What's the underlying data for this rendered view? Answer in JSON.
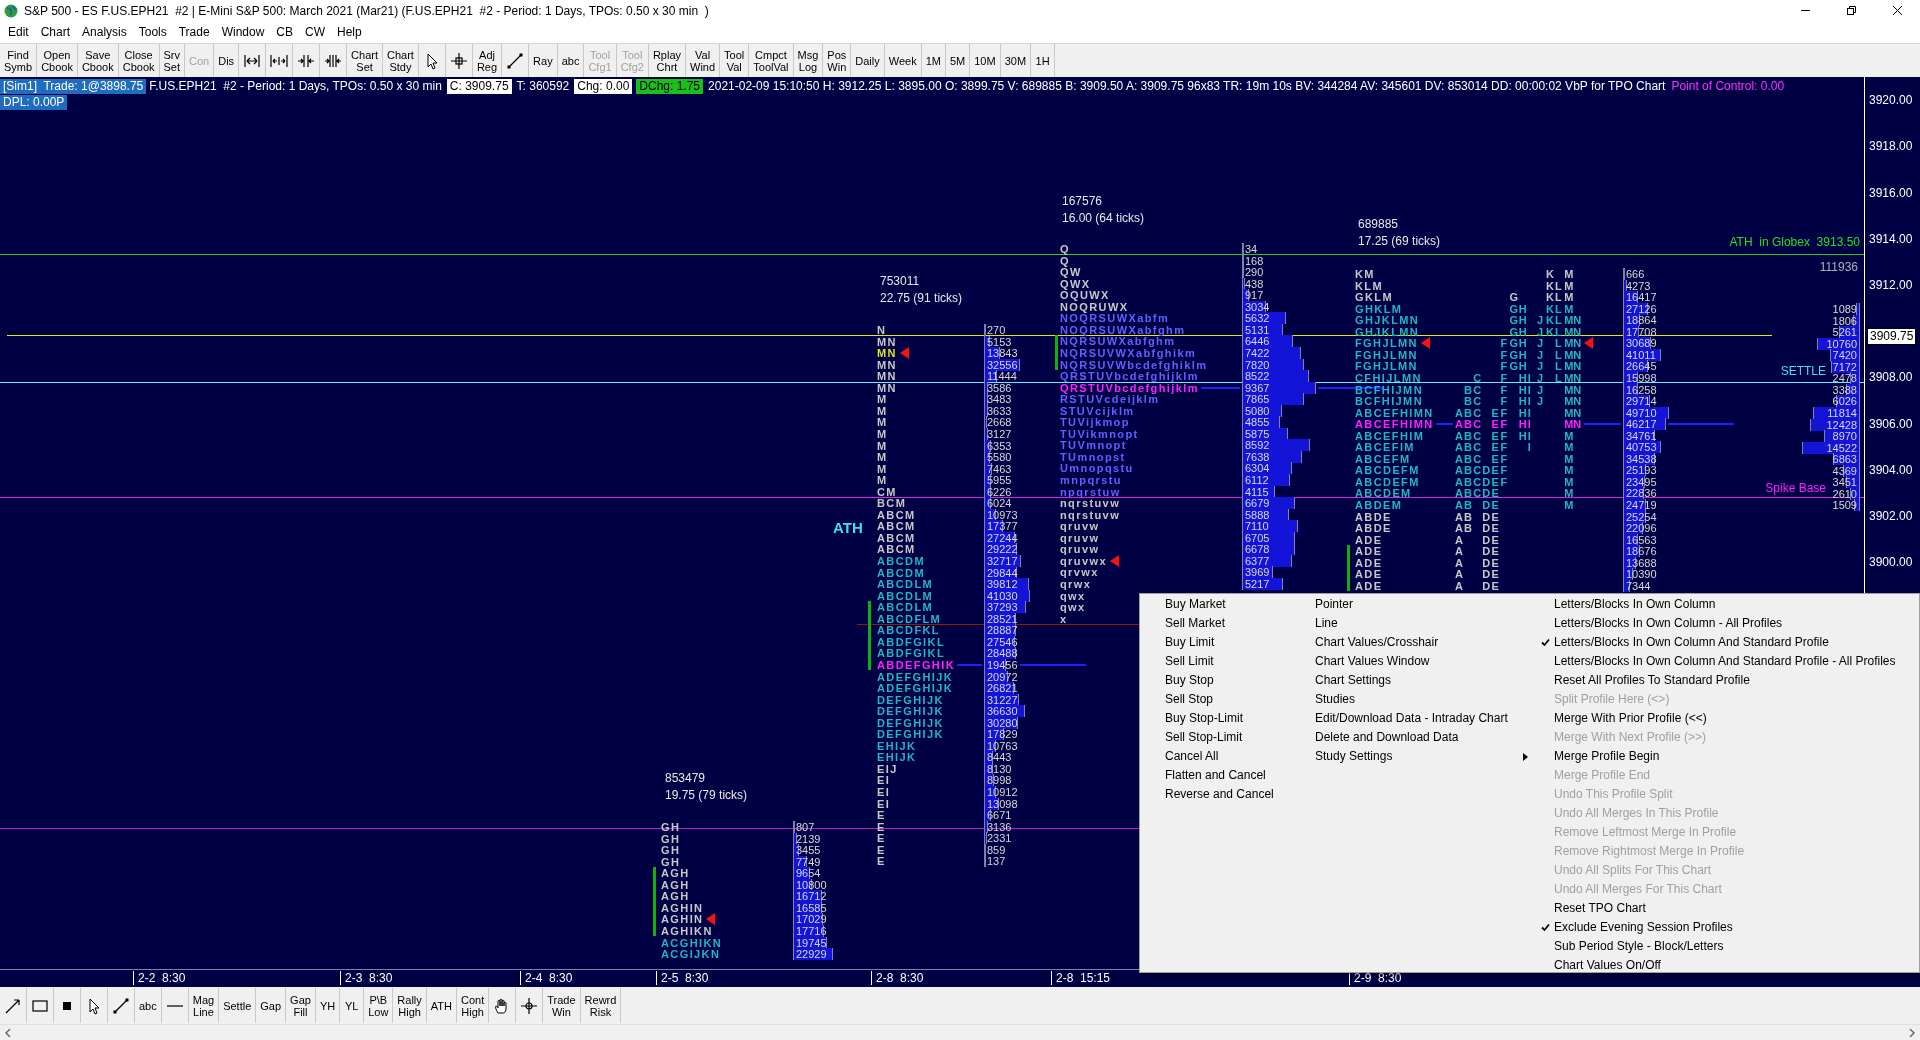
{
  "window": {
    "title": "S&P 500 - ES F.US.EPH21  #2 | E-Mini S&P 500: March 2021 (Mar21) (F.US.EPH21  #2 - Period: 1 Days, TPOs: 0.50 x 30 min  )"
  },
  "menu": [
    "Edit",
    "Chart",
    "Analysis",
    "Tools",
    "Trade",
    "Window",
    "CB",
    "CW",
    "Help"
  ],
  "toolbar": [
    {
      "kind": "text",
      "lines": [
        "Find",
        "Symb"
      ],
      "disabled": false
    },
    {
      "kind": "text",
      "lines": [
        "Open",
        "Cbook"
      ],
      "disabled": false
    },
    {
      "kind": "text",
      "lines": [
        "Save",
        "Cbook"
      ],
      "disabled": false
    },
    {
      "kind": "text",
      "lines": [
        "Close",
        "Cbook"
      ],
      "disabled": false
    },
    {
      "kind": "text",
      "lines": [
        "Srv",
        "Set"
      ],
      "disabled": false
    },
    {
      "kind": "text",
      "lines": [
        "Con"
      ],
      "disabled": true
    },
    {
      "kind": "text",
      "lines": [
        "Dis"
      ],
      "disabled": false
    },
    {
      "kind": "icon"
    },
    {
      "kind": "icon"
    },
    {
      "kind": "icon"
    },
    {
      "kind": "icon"
    },
    {
      "kind": "text",
      "lines": [
        "Chart",
        "Set"
      ],
      "disabled": false
    },
    {
      "kind": "text",
      "lines": [
        "Chart",
        "Stdy"
      ],
      "disabled": false
    },
    {
      "kind": "icon"
    },
    {
      "kind": "icon"
    },
    {
      "kind": "text",
      "lines": [
        "Adj",
        "Reg"
      ],
      "disabled": false
    },
    {
      "kind": "icon"
    },
    {
      "kind": "text",
      "lines": [
        "Ray"
      ],
      "disabled": false
    },
    {
      "kind": "text",
      "lines": [
        "abc"
      ],
      "disabled": false
    },
    {
      "kind": "text",
      "lines": [
        "Tool",
        "Cfg1"
      ],
      "disabled": true
    },
    {
      "kind": "text",
      "lines": [
        "Tool",
        "Cfg2"
      ],
      "disabled": true
    },
    {
      "kind": "text",
      "lines": [
        "Rplay",
        "Chrt"
      ],
      "disabled": false
    },
    {
      "kind": "text",
      "lines": [
        "Val",
        "Wind"
      ],
      "disabled": false
    },
    {
      "kind": "text",
      "lines": [
        "Tool",
        "Val"
      ],
      "disabled": false
    },
    {
      "kind": "text",
      "lines": [
        "Cmpct",
        "ToolVal"
      ],
      "disabled": false
    },
    {
      "kind": "text",
      "lines": [
        "Msg",
        "Log"
      ],
      "disabled": false
    },
    {
      "kind": "text",
      "lines": [
        "Pos",
        "Win"
      ],
      "disabled": false
    },
    {
      "kind": "text",
      "lines": [
        "Daily"
      ],
      "disabled": false
    },
    {
      "kind": "text",
      "lines": [
        "Week"
      ],
      "disabled": false
    },
    {
      "kind": "text",
      "lines": [
        "1M"
      ],
      "disabled": false
    },
    {
      "kind": "text",
      "lines": [
        "5M"
      ],
      "disabled": false
    },
    {
      "kind": "text",
      "lines": [
        "10M"
      ],
      "disabled": false
    },
    {
      "kind": "text",
      "lines": [
        "30M"
      ],
      "disabled": false
    },
    {
      "kind": "text",
      "lines": [
        "1H"
      ],
      "disabled": false
    }
  ],
  "info_bar": [
    [
      {
        "kind": "account",
        "text": "[Sim1]  Trade: 1@3898.75"
      },
      {
        "kind": "plain",
        "text": "F.US.EPH21  #2 - Period: 1 Days, TPOs: 0.50 x 30 min"
      },
      {
        "kind": "boxed",
        "text": "C: 3909.75"
      },
      {
        "kind": "plain",
        "text": "T: 360592"
      },
      {
        "kind": "boxed",
        "text": "Chg: 0.00"
      },
      {
        "kind": "up",
        "text": "DChg: 1.75"
      },
      {
        "kind": "plain",
        "text": "2021-02-09 15:10:50 H: 3912.25 L: 3895.00 O: 3899.75 V: 689885 B: 3909.50 A: 3909.75 96x83 TR: 19m 10s BV: 344284 AV: 345601 DV: 853014 DD: 00:00:02 VbP for TPO Chart"
      },
      {
        "kind": "poc",
        "text": "Point of Control: 0.00"
      }
    ],
    [
      {
        "kind": "account",
        "text": "DPL: 0.00P"
      }
    ]
  ],
  "profiles": [
    {
      "total": "753011",
      "range": "22.75 (91 ticks)",
      "rows": [
        {
          "letters": "N",
          "volume": "270",
          "color": "#c8c8c8"
        },
        {
          "letters": "MN",
          "volume": "5153",
          "color": "#c8c8c8"
        },
        {
          "letters": "MN",
          "volume": "13843",
          "color": "#e0e020",
          "close_marker": true
        },
        {
          "letters": "MN",
          "volume": "32556",
          "color": "#c8c8c8"
        },
        {
          "letters": "MN",
          "volume": "11444",
          "color": "#c8c8c8"
        },
        {
          "letters": "MN",
          "volume": "3586",
          "color": "#c8c8c8"
        },
        {
          "letters": "M",
          "volume": "3483",
          "color": "#c8c8c8"
        },
        {
          "letters": "M",
          "volume": "3633",
          "color": "#c8c8c8"
        },
        {
          "letters": "M",
          "volume": "2668",
          "color": "#c8c8c8"
        },
        {
          "letters": "M",
          "volume": "3127",
          "color": "#c8c8c8"
        },
        {
          "letters": "M",
          "volume": "6353",
          "color": "#c8c8c8"
        },
        {
          "letters": "M",
          "volume": "5580",
          "color": "#c8c8c8"
        },
        {
          "letters": "M",
          "volume": "7463",
          "color": "#c8c8c8"
        },
        {
          "letters": "M",
          "volume": "5955",
          "color": "#c8c8c8"
        },
        {
          "letters": "CM",
          "volume": "6226",
          "color": "#c8c8c8"
        },
        {
          "letters": "BCM",
          "volume": "6024",
          "color": "#c8c8c8"
        },
        {
          "letters": "ABCM",
          "volume": "10973",
          "color": "#c8c8c8"
        },
        {
          "letters": "ABCM",
          "volume": "17377",
          "color": "#c8c8c8"
        },
        {
          "letters": "ABCM",
          "volume": "27244",
          "color": "#c8c8c8"
        },
        {
          "letters": "ABCM",
          "volume": "29222",
          "color": "#c8c8c8"
        },
        {
          "letters": "ABCDM",
          "volume": "32717",
          "color": "#20b8c0"
        },
        {
          "letters": "ABCDM",
          "volume": "29844",
          "color": "#20b8c0"
        },
        {
          "letters": "ABCDLM",
          "volume": "39812",
          "color": "#20b8c0"
        },
        {
          "letters": "ABCDLM",
          "volume": "41030",
          "color": "#20b8c0"
        },
        {
          "letters": "ABCDLM",
          "volume": "37293",
          "color": "#20b8c0"
        },
        {
          "letters": "ABCDFLM",
          "volume": "28521",
          "color": "#20b8c0"
        },
        {
          "letters": "ABCDFKL",
          "volume": "28887",
          "color": "#20b8c0"
        },
        {
          "letters": "ABDFGIKL",
          "volume": "27546",
          "color": "#20b8c0"
        },
        {
          "letters": "ABDFGIKL",
          "volume": "28488",
          "color": "#20b8c0"
        },
        {
          "letters": "ABDEFGHIK",
          "volume": "19456",
          "color": "#ff20ff",
          "poc": true
        },
        {
          "letters": "ADEFGHIJK",
          "volume": "20972",
          "color": "#20b8c0"
        },
        {
          "letters": "ADEFGHIJK",
          "volume": "26821",
          "color": "#20b8c0"
        },
        {
          "letters": "DEFGHIJK",
          "volume": "31227",
          "color": "#20b8c0"
        },
        {
          "letters": "DEFGHIJK",
          "volume": "36630",
          "color": "#20b8c0"
        },
        {
          "letters": "DEFGHIJK",
          "volume": "30280",
          "color": "#20b8c0"
        },
        {
          "letters": "DEFGHIJK",
          "volume": "17829",
          "color": "#20b8c0"
        },
        {
          "letters": "EHIJK",
          "volume": "10763",
          "color": "#20b8c0"
        },
        {
          "letters": "EHIJK",
          "volume": "8443",
          "color": "#20b8c0"
        },
        {
          "letters": "EIJ",
          "volume": "8130",
          "color": "#c8c8c8"
        },
        {
          "letters": "EI",
          "volume": "8998",
          "color": "#c8c8c8"
        },
        {
          "letters": "EI",
          "volume": "10912",
          "color": "#c8c8c8"
        },
        {
          "letters": "EI",
          "volume": "13098",
          "color": "#c8c8c8"
        },
        {
          "letters": "E",
          "volume": "6671",
          "color": "#c8c8c8"
        },
        {
          "letters": "E",
          "volume": "3136",
          "color": "#c8c8c8"
        },
        {
          "letters": "E",
          "volume": "2331",
          "color": "#c8c8c8"
        },
        {
          "letters": "E",
          "volume": "859",
          "color": "#c8c8c8"
        },
        {
          "letters": "E",
          "volume": "137",
          "color": "#c8c8c8"
        }
      ]
    },
    {
      "total": "167576",
      "range": "16.00 (64 ticks)",
      "rows": [
        {
          "letters": "Q",
          "volume": "34",
          "color": "#c8c8c8"
        },
        {
          "letters": "Q",
          "volume": "168",
          "color": "#c8c8c8"
        },
        {
          "letters": "QW",
          "volume": "290",
          "color": "#c8c8c8"
        },
        {
          "letters": "QWX",
          "volume": "438",
          "color": "#c8c8c8"
        },
        {
          "letters": "OQUWX",
          "volume": "917",
          "color": "#c8c8c8"
        },
        {
          "letters": "NOQRUWX",
          "volume": "3034",
          "color": "#c8c8c8"
        },
        {
          "letters": "NOQRSUWXabfm",
          "volume": "5632",
          "color": "#6060ff"
        },
        {
          "letters": "NOQRSUWXabfghm",
          "volume": "5131",
          "color": "#6060ff"
        },
        {
          "letters": "NQRSUWXabfghm",
          "volume": "6446",
          "color": "#6060ff"
        },
        {
          "letters": "NQRSUVWXabfghikm",
          "volume": "7422",
          "color": "#6060ff"
        },
        {
          "letters": "NQRSUVWbcdefghiklm",
          "volume": "7820",
          "color": "#6060ff"
        },
        {
          "letters": "QRSTUVbcdefghijklm",
          "volume": "8522",
          "color": "#6060ff"
        },
        {
          "letters": "QRSTUVbcdefghijklm",
          "volume": "9367",
          "color": "#ff20ff",
          "poc": true
        },
        {
          "letters": "RSTUVcdeijklm",
          "volume": "7865",
          "color": "#6060ff"
        },
        {
          "letters": "STUVcijklm",
          "volume": "5080",
          "color": "#6060ff"
        },
        {
          "letters": "TUVijkmop",
          "volume": "4855",
          "color": "#6060ff"
        },
        {
          "letters": "TUVikmnopt",
          "volume": "5875",
          "color": "#6060ff"
        },
        {
          "letters": "TUVmnopt",
          "volume": "8592",
          "color": "#6060ff"
        },
        {
          "letters": "TUmnopst",
          "volume": "7638",
          "color": "#6060ff"
        },
        {
          "letters": "Umnopqstu",
          "volume": "6304",
          "color": "#6060ff"
        },
        {
          "letters": "mnpqrstu",
          "volume": "6112",
          "color": "#6060ff"
        },
        {
          "letters": "npqrstuw",
          "volume": "4115",
          "color": "#6060ff"
        },
        {
          "letters": "nqrstuvw",
          "volume": "6679",
          "color": "#c8c8c8"
        },
        {
          "letters": "nqrstuvw",
          "volume": "5888",
          "color": "#c8c8c8"
        },
        {
          "letters": "qruvw",
          "volume": "7110",
          "color": "#c8c8c8"
        },
        {
          "letters": "qruvw",
          "volume": "6705",
          "color": "#c8c8c8"
        },
        {
          "letters": "qruvw",
          "volume": "6678",
          "color": "#c8c8c8"
        },
        {
          "letters": "qruvwx",
          "volume": "6377",
          "color": "#c8c8c8",
          "close_marker": true
        },
        {
          "letters": "qrvwx",
          "volume": "3969",
          "color": "#c8c8c8"
        },
        {
          "letters": "qrwx",
          "volume": "5217",
          "color": "#c8c8c8"
        },
        {
          "letters": "qwx",
          "color": "#c8c8c8"
        },
        {
          "letters": "qwx",
          "color": "#c8c8c8"
        },
        {
          "letters": "x",
          "color": "#c8c8c8"
        }
      ]
    },
    {
      "total": "689885",
      "range": "17.25 (69 ticks)",
      "rows": [
        {
          "letters": "KM",
          "own_column": [
            "K",
            "M"
          ],
          "volume": "666",
          "color": "#c8c8c8"
        },
        {
          "letters": "KLM",
          "own_column": [
            "KLM"
          ],
          "volume": "4273",
          "color": "#c8c8c8"
        },
        {
          "letters": "GKLM",
          "own_column": [
            "G",
            "KLM"
          ],
          "volume": "16417",
          "color": "#c8c8c8"
        },
        {
          "letters": "GHKLM",
          "own_column": [
            "GH",
            "KLM"
          ],
          "volume": "27126",
          "color": "#20b8c0"
        },
        {
          "letters": "GHJKLMN",
          "own_column": [
            "GH",
            "JKLMN"
          ],
          "volume": "18864",
          "color": "#20b8c0"
        },
        {
          "letters": "GHJKLMN",
          "own_column": [
            "GH",
            "JKLMN"
          ],
          "volume": "17708",
          "color": "#20b8c0"
        },
        {
          "letters": "FGHJLMN",
          "own_column": [
            "FGH",
            "J",
            "LMN"
          ],
          "volume": "30689",
          "color": "#20b8c0",
          "close_marker": true
        },
        {
          "letters": "FGHJLMN",
          "own_column": [
            "FGH",
            "J",
            "LMN"
          ],
          "volume": "41011",
          "color": "#20b8c0"
        },
        {
          "letters": "FGHJLMN",
          "own_column": [
            "FGH",
            "J",
            "LMN"
          ],
          "volume": "26645",
          "color": "#20b8c0"
        },
        {
          "letters": "CFHIJLMN",
          "own_column": [
            "C",
            "F",
            "HI",
            "J",
            "LMN"
          ],
          "volume": "15998",
          "color": "#20b8c0"
        },
        {
          "letters": "BCFHIJMN",
          "own_column": [
            "BC",
            "F",
            "HI",
            "J",
            "MN"
          ],
          "volume": "16258",
          "color": "#20b8c0"
        },
        {
          "letters": "BCFHIJMN",
          "own_column": [
            "BC",
            "F",
            "HI",
            "J",
            "MN"
          ],
          "volume": "29714",
          "color": "#20b8c0"
        },
        {
          "letters": "ABCEFHIMN",
          "own_column": [
            "ABC",
            "EF",
            "HI",
            "MN"
          ],
          "volume": "49710",
          "color": "#20b8c0"
        },
        {
          "letters": "ABCEFHIMN",
          "own_column": [
            "ABC",
            "EF",
            "HI",
            "MN"
          ],
          "volume": "46217",
          "color": "#ff20ff",
          "poc": true
        },
        {
          "letters": "ABCEFHIM",
          "own_column": [
            "ABC",
            "EF",
            "HI",
            "M"
          ],
          "volume": "34761",
          "color": "#20b8c0"
        },
        {
          "letters": "ABCEFIM",
          "own_column": [
            "ABC",
            "EF",
            "I",
            "M"
          ],
          "volume": "40753",
          "color": "#20b8c0"
        },
        {
          "letters": "ABCEFM",
          "own_column": [
            "ABC",
            "EF",
            "M"
          ],
          "volume": "34538",
          "color": "#20b8c0"
        },
        {
          "letters": "ABCDEFM",
          "own_column": [
            "ABCDEF",
            "M"
          ],
          "volume": "25193",
          "color": "#20b8c0"
        },
        {
          "letters": "ABCDEFM",
          "own_column": [
            "ABCDEF",
            "M"
          ],
          "volume": "23495",
          "color": "#20b8c0"
        },
        {
          "letters": "ABCDEM",
          "own_column": [
            "ABCDE",
            "M"
          ],
          "volume": "22836",
          "color": "#20b8c0"
        },
        {
          "letters": "ABDEM",
          "own_column": [
            "AB",
            "DE",
            "M"
          ],
          "volume": "24719",
          "color": "#20b8c0"
        },
        {
          "letters": "ABDE",
          "own_column": [
            "AB",
            "DE"
          ],
          "volume": "25254",
          "color": "#c8c8c8"
        },
        {
          "letters": "ABDE",
          "own_column": [
            "AB",
            "DE"
          ],
          "volume": "22096",
          "color": "#c8c8c8"
        },
        {
          "letters": "ADE",
          "own_column": [
            "A",
            "DE"
          ],
          "volume": "16563",
          "color": "#c8c8c8"
        },
        {
          "letters": "ADE",
          "own_column": [
            "A",
            "DE"
          ],
          "volume": "18676",
          "color": "#c8c8c8"
        },
        {
          "letters": "ADE",
          "own_column": [
            "A",
            "DE"
          ],
          "volume": "13688",
          "color": "#c8c8c8"
        },
        {
          "letters": "ADE",
          "own_column": [
            "A",
            "DE"
          ],
          "volume": "10390",
          "color": "#c8c8c8"
        },
        {
          "letters": "ADE",
          "own_column": [
            "A",
            "DE"
          ],
          "volume": "7344",
          "color": "#c8c8c8"
        }
      ]
    },
    {
      "total": "111936",
      "rows": [
        {
          "volume": "1089"
        },
        {
          "volume": "1806"
        },
        {
          "volume": "5261"
        },
        {
          "volume": "10760"
        },
        {
          "volume": "7420"
        },
        {
          "volume": "7172"
        },
        {
          "volume": "2478"
        },
        {
          "volume": "3388"
        },
        {
          "volume": "6026"
        },
        {
          "volume": "11814"
        },
        {
          "volume": "12428"
        },
        {
          "volume": "8970"
        },
        {
          "volume": "14522"
        },
        {
          "volume": "6863"
        },
        {
          "volume": "4369"
        },
        {
          "volume": "3451"
        },
        {
          "volume": "2610"
        },
        {
          "volume": "1509"
        }
      ]
    },
    {
      "total": "853479",
      "range": "19.75 (79 ticks)",
      "rows": [
        {
          "letters": "GH",
          "volume": "807",
          "color": "#c8c8c8"
        },
        {
          "letters": "GH",
          "volume": "2139",
          "color": "#c8c8c8"
        },
        {
          "letters": "GH",
          "volume": "3455",
          "color": "#c8c8c8"
        },
        {
          "letters": "GH",
          "volume": "7749",
          "color": "#c8c8c8"
        },
        {
          "letters": "AGH",
          "volume": "9654",
          "color": "#c8c8c8"
        },
        {
          "letters": "AGH",
          "volume": "10800",
          "color": "#c8c8c8"
        },
        {
          "letters": "AGH",
          "volume": "16712",
          "color": "#c8c8c8"
        },
        {
          "letters": "AGHIN",
          "volume": "16585",
          "color": "#c8c8c8"
        },
        {
          "letters": "AGHIN",
          "volume": "17029",
          "color": "#c8c8c8",
          "close_marker": true
        },
        {
          "letters": "AGHIKN",
          "volume": "17716",
          "color": "#c8c8c8"
        },
        {
          "letters": "ACGHIKN",
          "volume": "19745",
          "color": "#20b8c0"
        },
        {
          "letters": "ACGIJKN",
          "volume": "22929",
          "color": "#20b8c0"
        }
      ]
    }
  ],
  "chart_labels": [
    {
      "kind": "ath",
      "text": "ATH"
    },
    {
      "kind": "globex",
      "text": "ATH  in Globex  3913.50"
    },
    {
      "kind": "settle",
      "text": "SETTLE"
    },
    {
      "kind": "spike",
      "text": "Spike Base"
    }
  ],
  "price_axis": {
    "labels": [
      "3920.00",
      "3918.00",
      "3916.00",
      "3914.00",
      "3912.00",
      "3908.00",
      "3906.00",
      "3904.00",
      "3902.00",
      "3900.00"
    ],
    "current": "3909.75"
  },
  "time_axis": [
    "2-2  8:30",
    "2-3  8:30",
    "2-4  8:30",
    "2-5  8:30",
    "2-8  8:30",
    "2-8  15:15",
    "2-9  8:30"
  ],
  "context_menu": {
    "column_1": [
      "Buy Market",
      "Sell Market",
      "Buy Limit",
      "Sell Limit",
      "Buy Stop",
      "Sell Stop",
      "Buy Stop-Limit",
      "Sell Stop-Limit",
      "Cancel All",
      "Flatten and Cancel",
      "Reverse and Cancel"
    ],
    "column_2": [
      {
        "label": "Pointer",
        "submenu": false
      },
      {
        "label": "Line",
        "submenu": false
      },
      {
        "label": "Chart Values/Crosshair",
        "submenu": false
      },
      {
        "label": "Chart Values Window",
        "submenu": false
      },
      {
        "label": "Chart Settings",
        "submenu": false
      },
      {
        "label": "Studies",
        "submenu": false
      },
      {
        "label": "Edit/Download Data - Intraday Chart",
        "submenu": false
      },
      {
        "label": "Delete and Download Data",
        "submenu": false
      },
      {
        "label": "Study Settings",
        "submenu": true
      }
    ],
    "column_3": [
      {
        "label": "Letters/Blocks In Own Column",
        "checked": false,
        "disabled": false
      },
      {
        "label": "Letters/Blocks In Own Column - All Profiles",
        "checked": false,
        "disabled": false
      },
      {
        "label": "Letters/Blocks In Own Column And Standard Profile",
        "checked": true,
        "disabled": false
      },
      {
        "label": "Letters/Blocks In Own Column And Standard Profile - All Profiles",
        "checked": false,
        "disabled": false
      },
      {
        "label": "Reset All Profiles To Standard Profile",
        "checked": false,
        "disabled": false
      },
      {
        "label": "Split Profile Here (<>)",
        "checked": false,
        "disabled": true
      },
      {
        "label": "Merge With Prior Profile (<<)",
        "checked": false,
        "disabled": false
      },
      {
        "label": "Merge With Next Profile (>>)",
        "checked": false,
        "disabled": true
      },
      {
        "label": "Merge Profile Begin",
        "checked": false,
        "disabled": false
      },
      {
        "label": "Merge Profile End",
        "checked": false,
        "disabled": true
      },
      {
        "label": "Undo This Profile Split",
        "checked": false,
        "disabled": true
      },
      {
        "label": "Undo All Merges In This Profile",
        "checked": false,
        "disabled": true
      },
      {
        "label": "Remove Leftmost Merge In Profile",
        "checked": false,
        "disabled": true
      },
      {
        "label": "Remove Rightmost Merge In Profile",
        "checked": false,
        "disabled": true
      },
      {
        "label": "Undo All Splits For This Chart",
        "checked": false,
        "disabled": true
      },
      {
        "label": "Undo All Merges For This Chart",
        "checked": false,
        "disabled": true
      },
      {
        "label": "Reset TPO Chart",
        "checked": false,
        "disabled": false
      },
      {
        "label": "Exclude Evening Session Profiles",
        "checked": true,
        "disabled": false
      },
      {
        "label": "Sub Period Style - Block/Letters",
        "checked": false,
        "disabled": false
      },
      {
        "label": "Chart Values On/Off",
        "checked": false,
        "disabled": false
      }
    ]
  },
  "bottom_toolbar": [
    {
      "kind": "icon"
    },
    {
      "kind": "icon"
    },
    {
      "kind": "icon"
    },
    {
      "kind": "icon"
    },
    {
      "kind": "icon"
    },
    {
      "kind": "text",
      "lines": [
        "abc"
      ]
    },
    {
      "kind": "icon"
    },
    {
      "kind": "text",
      "lines": [
        "Mag",
        "Line"
      ]
    },
    {
      "kind": "text",
      "lines": [
        "Settle"
      ]
    },
    {
      "kind": "text",
      "lines": [
        "Gap"
      ]
    },
    {
      "kind": "text",
      "lines": [
        "Gap",
        "Fill"
      ]
    },
    {
      "kind": "text",
      "lines": [
        "YH"
      ]
    },
    {
      "kind": "text",
      "lines": [
        "YL"
      ]
    },
    {
      "kind": "text",
      "lines": [
        "P\\B",
        "Low"
      ]
    },
    {
      "kind": "text",
      "lines": [
        "Rally",
        "High"
      ]
    },
    {
      "kind": "text",
      "lines": [
        "ATH"
      ]
    },
    {
      "kind": "text",
      "lines": [
        "Cont",
        "High"
      ]
    },
    {
      "kind": "icon"
    },
    {
      "kind": "icon"
    },
    {
      "kind": "text",
      "lines": [
        "Trade",
        "Win"
      ]
    },
    {
      "kind": "text",
      "lines": [
        "Rewrd",
        "Risk"
      ]
    }
  ]
}
